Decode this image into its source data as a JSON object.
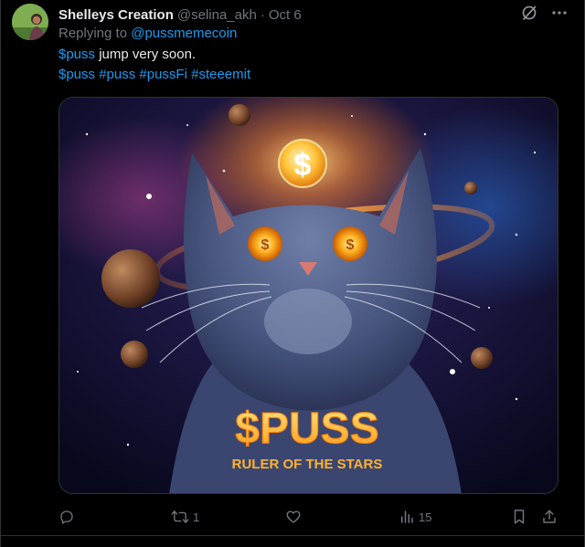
{
  "tweet": {
    "author_name": "Shelleys Creation",
    "author_handle": "@selina_akh",
    "separator": "·",
    "date": "Oct 6",
    "replying_to_prefix": "Replying to ",
    "replying_to_handle": "@pussmemecoin",
    "line1_cashtag": "$puss",
    "line1_text": " jump very soon.",
    "hashtags": [
      "$puss",
      "#puss",
      "#pussFi",
      "#steeemit"
    ]
  },
  "media": {
    "title_text": "$PUSS",
    "subtitle_text": "RULER OF THE STARS",
    "coin_symbol": "$",
    "eye_symbol": "$"
  },
  "actions": {
    "reply_count": "",
    "retweet_count": "1",
    "like_count": "",
    "views_count": "15"
  },
  "colors": {
    "background": "#000000",
    "text_primary": "#e7e9ea",
    "text_secondary": "#71767b",
    "link": "#1d9bf0",
    "border": "#2f3336"
  },
  "icons": {
    "grok": "grok-icon",
    "more": "more-icon",
    "reply": "reply-icon",
    "retweet": "retweet-icon",
    "like": "like-icon",
    "views": "views-icon",
    "bookmark": "bookmark-icon",
    "share": "share-icon"
  }
}
